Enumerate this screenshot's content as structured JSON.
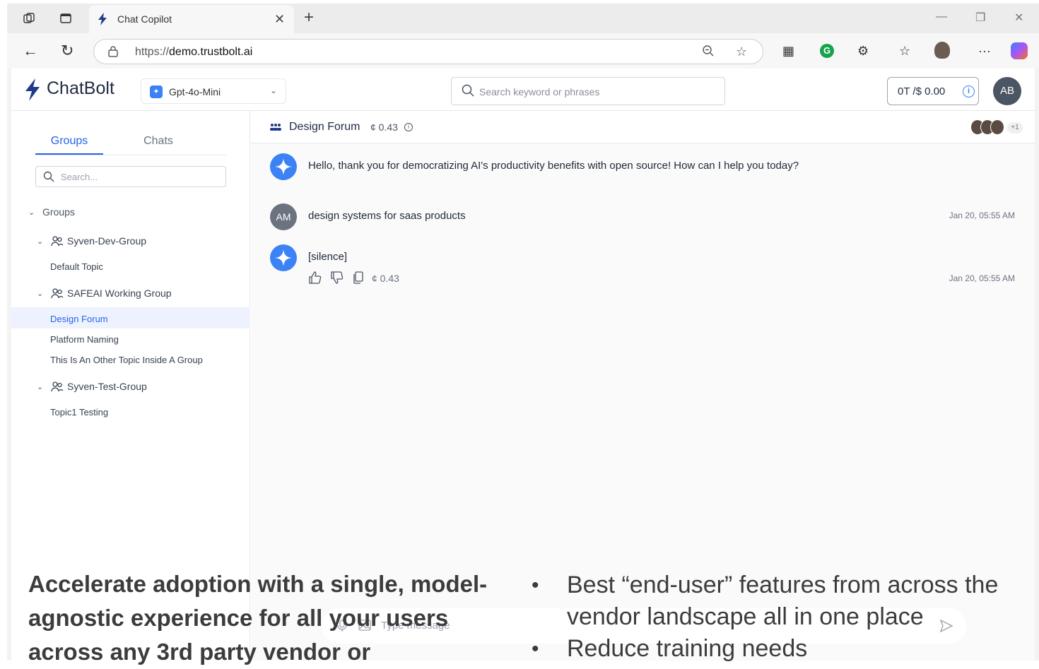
{
  "browser": {
    "tab_title": "Chat Copilot",
    "url_prefix": "https://",
    "url_host": "demo.trustbolt.ai"
  },
  "app": {
    "logo_text": "ChatBolt",
    "model": "Gpt-4o-Mini",
    "search_placeholder": "Search keyword or phrases",
    "token_summary": "0T /$ 0.00",
    "user_initials": "AB",
    "accent_color": "#2563eb"
  },
  "sidebar": {
    "tabs": [
      "Groups",
      "Chats"
    ],
    "search_placeholder": "Search...",
    "root_label": "Groups",
    "groups": [
      {
        "name": "Syven-Dev-Group",
        "topics": [
          "Default Topic"
        ]
      },
      {
        "name": "SAFEAI Working Group",
        "topics": [
          "Design Forum",
          "Platform Naming",
          "This Is An Other Topic Inside A Group"
        ]
      },
      {
        "name": "Syven-Test-Group",
        "topics": [
          "Topic1 Testing"
        ]
      }
    ],
    "active_topic": "Design Forum"
  },
  "chat": {
    "title": "Design Forum",
    "cost": "¢ 0.43",
    "participants_more": "+1",
    "messages": [
      {
        "role": "assistant",
        "text": "Hello, thank you for democratizing AI's productivity benefits with open source! How can I help you today?",
        "time": ""
      },
      {
        "role": "user",
        "initials": "AM",
        "text": "design systems for saas products",
        "time": "Jan 20, 05:55 AM"
      },
      {
        "role": "assistant",
        "text": "[silence]",
        "time": "Jan 20, 05:55 AM",
        "cost": "¢ 0.43"
      }
    ],
    "composer_placeholder": "Type message"
  },
  "overlay": {
    "left_text": "Accelerate adoption with a single, model-agnostic experience for all your users across any 3rd party vendor or",
    "bullets": [
      "Best “end-user” features from across the vendor landscape all in one place",
      "Reduce training needs"
    ]
  }
}
